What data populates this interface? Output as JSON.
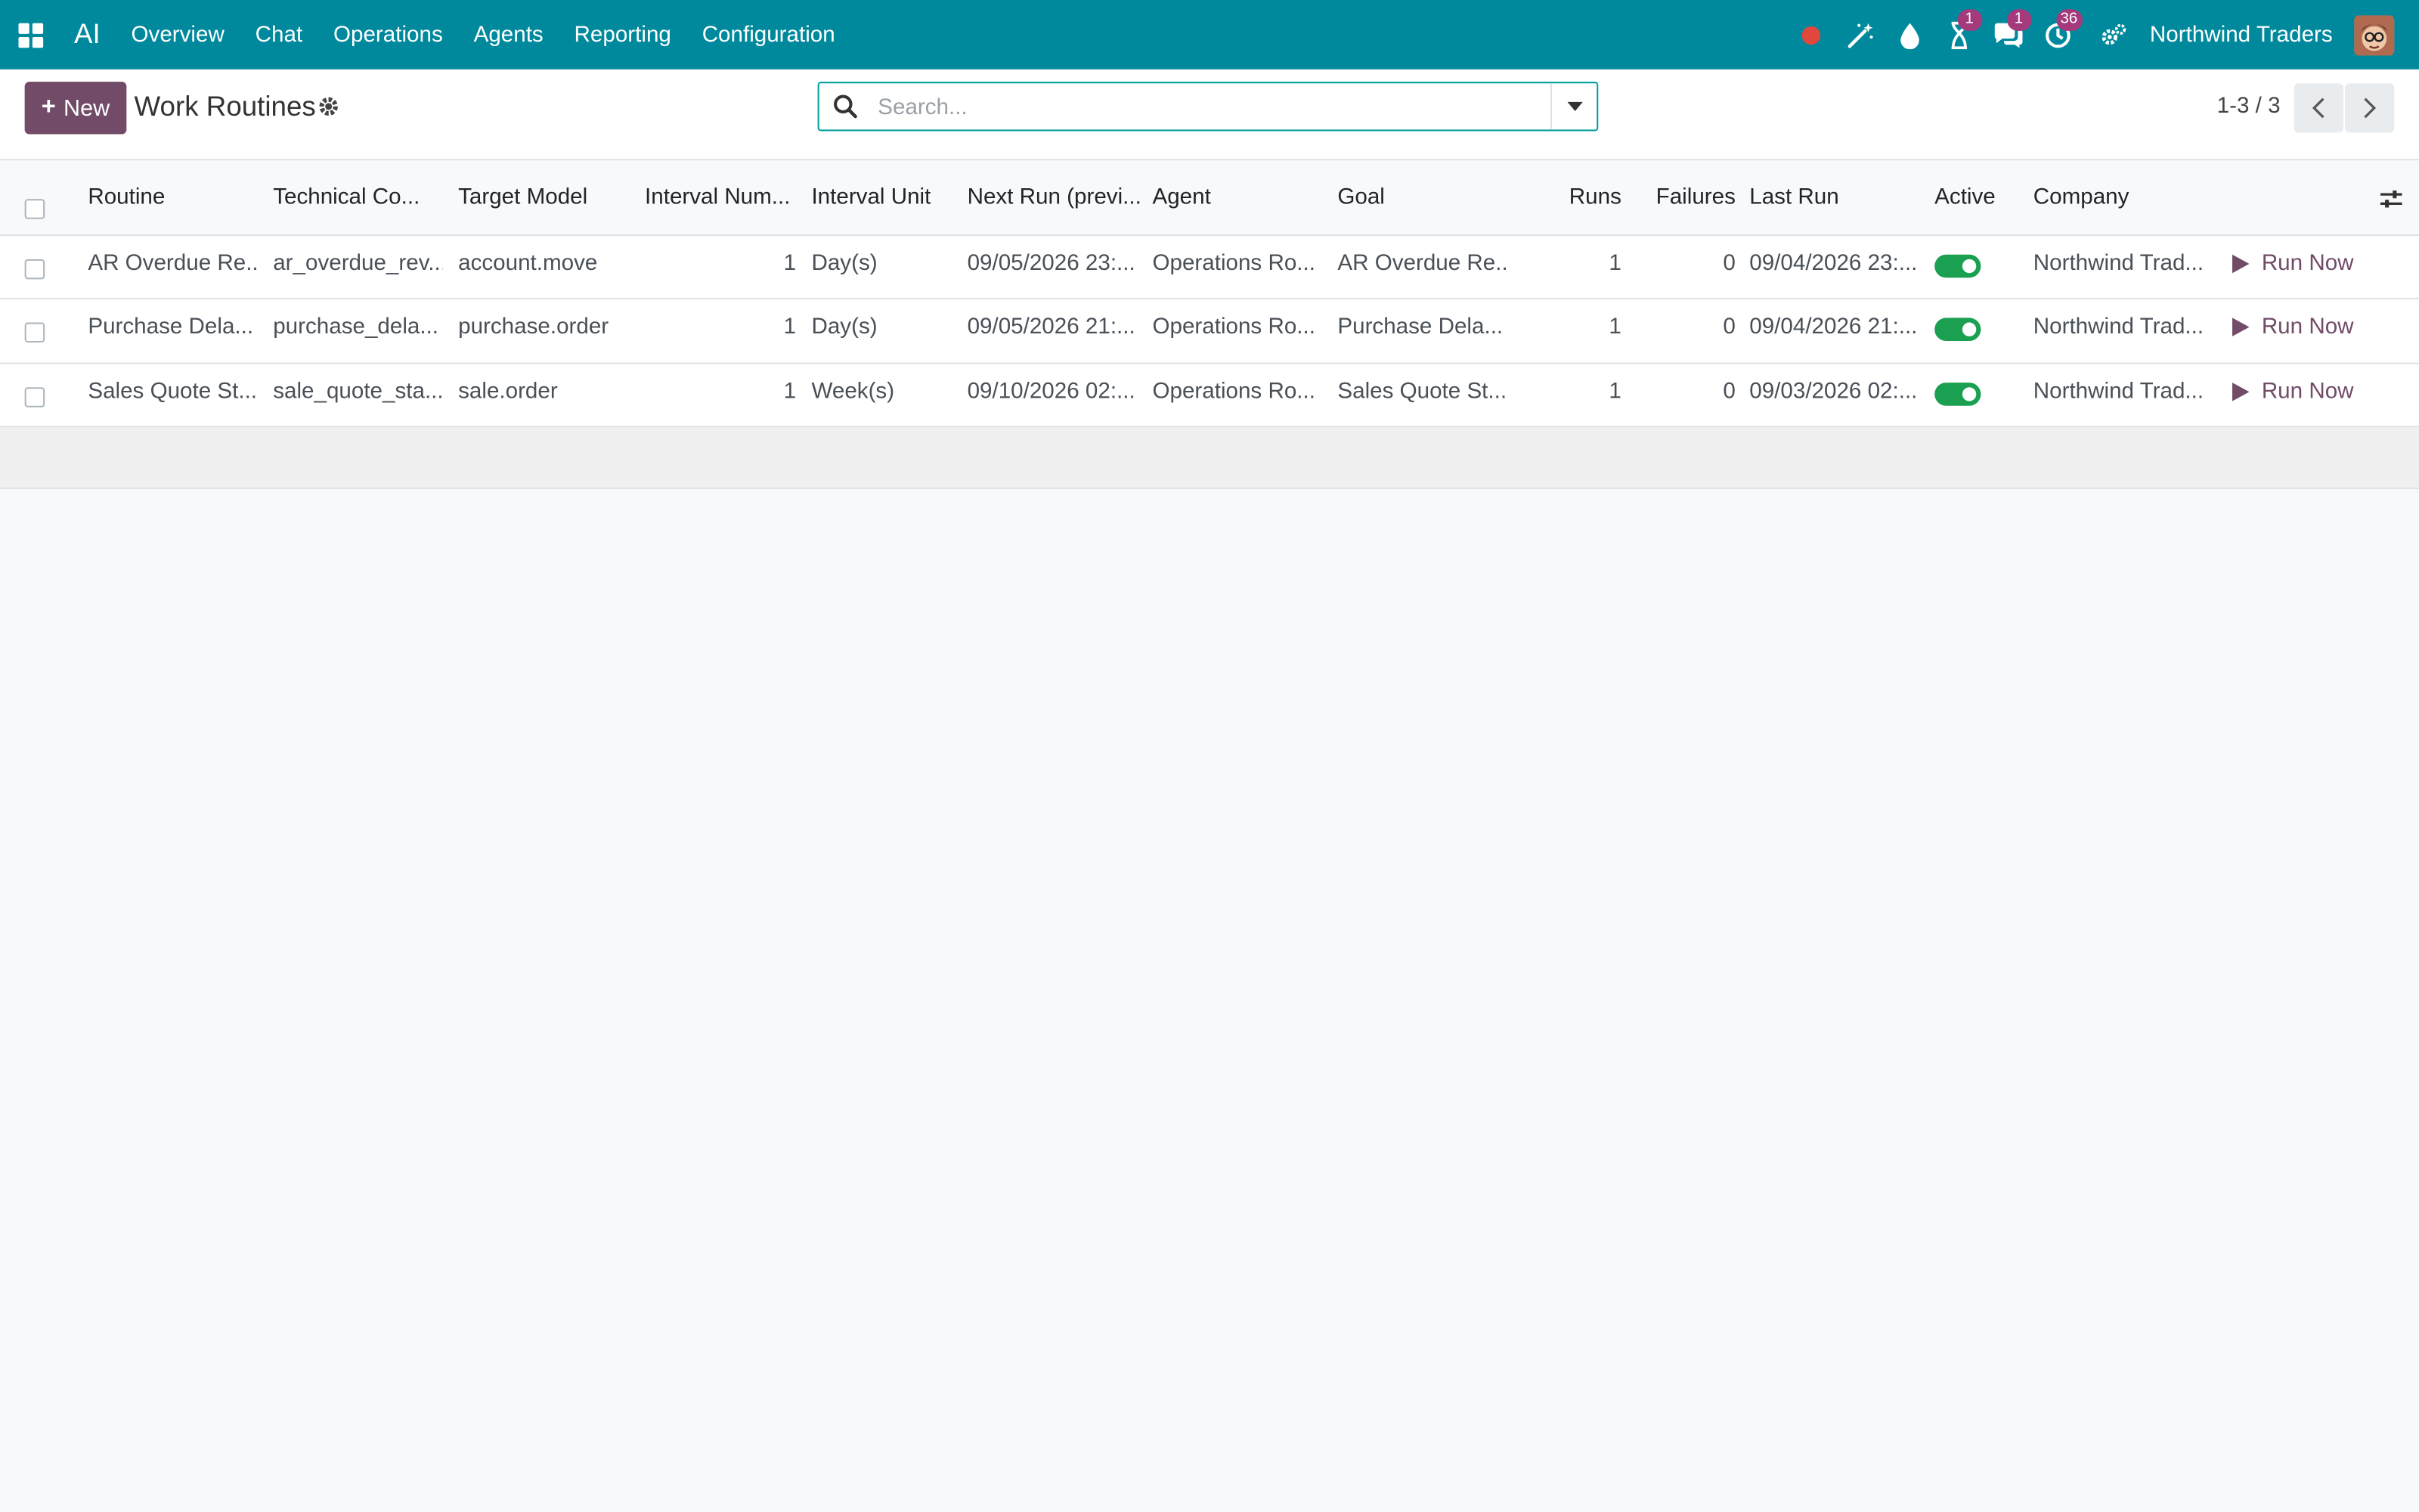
{
  "app": {
    "name": "AI"
  },
  "menu": [
    "Overview",
    "Chat",
    "Operations",
    "Agents",
    "Reporting",
    "Configuration"
  ],
  "systray": {
    "activity_badge": "1",
    "messages_badge": "1",
    "clock_badge": "36",
    "company": "Northwind Traders"
  },
  "control": {
    "new_label": "New",
    "title": "Work Routines",
    "search_placeholder": "Search...",
    "pager": "1-3 / 3"
  },
  "table": {
    "headers": {
      "routine": "Routine",
      "technical": "Technical Co...",
      "model": "Target Model",
      "interval_num": "Interval Num...",
      "interval_unit": "Interval Unit",
      "next_run": "Next Run (previ...",
      "agent": "Agent",
      "goal": "Goal",
      "runs": "Runs",
      "failures": "Failures",
      "last_run": "Last Run",
      "active": "Active",
      "company": "Company"
    },
    "rows": [
      {
        "routine": "AR Overdue Re...",
        "technical": "ar_overdue_rev...",
        "model": "account.move",
        "interval_num": "1",
        "interval_unit": "Day(s)",
        "next_run": "09/05/2026 23:...",
        "agent": "Operations Ro...",
        "goal": "AR Overdue Re...",
        "runs": "1",
        "failures": "0",
        "last_run": "09/04/2026 23:...",
        "active": true,
        "company": "Northwind Trad...",
        "action": "Run Now"
      },
      {
        "routine": "Purchase Dela...",
        "technical": "purchase_dela...",
        "model": "purchase.order",
        "interval_num": "1",
        "interval_unit": "Day(s)",
        "next_run": "09/05/2026 21:...",
        "agent": "Operations Ro...",
        "goal": "Purchase Dela...",
        "runs": "1",
        "failures": "0",
        "last_run": "09/04/2026 21:...",
        "active": true,
        "company": "Northwind Trad...",
        "action": "Run Now"
      },
      {
        "routine": "Sales Quote St...",
        "technical": "sale_quote_sta...",
        "model": "sale.order",
        "interval_num": "1",
        "interval_unit": "Week(s)",
        "next_run": "09/10/2026 02:...",
        "agent": "Operations Ro...",
        "goal": "Sales Quote St...",
        "runs": "1",
        "failures": "0",
        "last_run": "09/03/2026 02:...",
        "active": true,
        "company": "Northwind Trad...",
        "action": "Run Now"
      }
    ]
  },
  "colors": {
    "navbar": "#00899c",
    "primary": "#714b67",
    "toggle_on": "#1aa050",
    "badge": "#a43a7c",
    "record_dot": "#e0483d"
  }
}
